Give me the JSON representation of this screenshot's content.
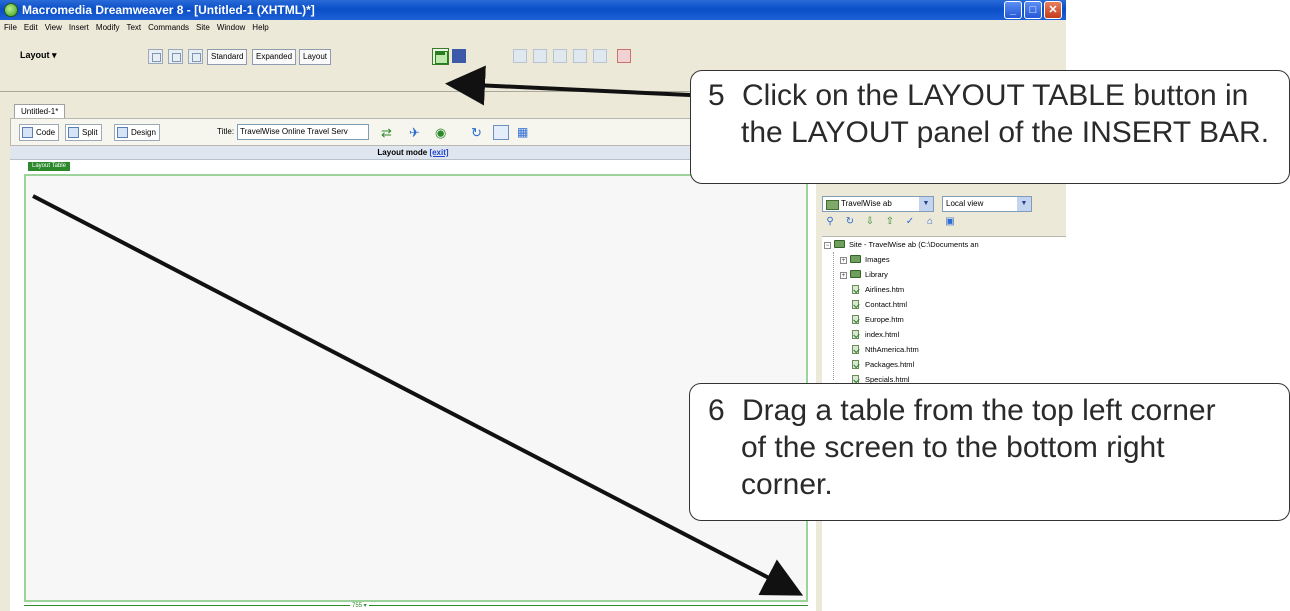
{
  "window": {
    "title": "Macromedia Dreamweaver 8 - [Untitled-1 (XHTML)*]",
    "controls": [
      "_",
      "□",
      "✕"
    ]
  },
  "menu": [
    "File",
    "Edit",
    "View",
    "Insert",
    "Modify",
    "Text",
    "Commands",
    "Site",
    "Window",
    "Help"
  ],
  "insert_bar": {
    "category": "Layout",
    "modes": [
      "Standard",
      "Expanded",
      "Layout"
    ]
  },
  "document": {
    "tab": "Untitled-1*",
    "views": [
      "Code",
      "Split",
      "Design"
    ],
    "title_label": "Title:",
    "title_value": "TravelWise Online Travel Serv",
    "layout_mode_label": "Layout mode",
    "layout_mode_exit": "[exit]",
    "layout_table_tab": "Layout Table",
    "table_width": "755 ▾"
  },
  "files_panel": {
    "site": "TravelWise ab",
    "view": "Local view",
    "tree": [
      {
        "label": "Site - TravelWise ab (C:\\Documents an",
        "type": "site"
      },
      {
        "label": "Images",
        "type": "folder"
      },
      {
        "label": "Library",
        "type": "folder"
      },
      {
        "label": "Airlines.htm",
        "type": "file"
      },
      {
        "label": "Contact.html",
        "type": "file"
      },
      {
        "label": "Europe.htm",
        "type": "file"
      },
      {
        "label": "index.html",
        "type": "file"
      },
      {
        "label": "NthAmerica.htm",
        "type": "file"
      },
      {
        "label": "Packages.html",
        "type": "file"
      },
      {
        "label": "Specials.html",
        "type": "file"
      }
    ]
  },
  "callouts": {
    "step5": {
      "number": "5",
      "line1": "Click on the LAYOUT TABLE button in",
      "line2": "the LAYOUT panel of the INSERT BAR."
    },
    "step6": {
      "number": "6",
      "line1": "Drag a table from the top left corner",
      "line2": "of the screen to the bottom right",
      "line3": "corner."
    }
  }
}
